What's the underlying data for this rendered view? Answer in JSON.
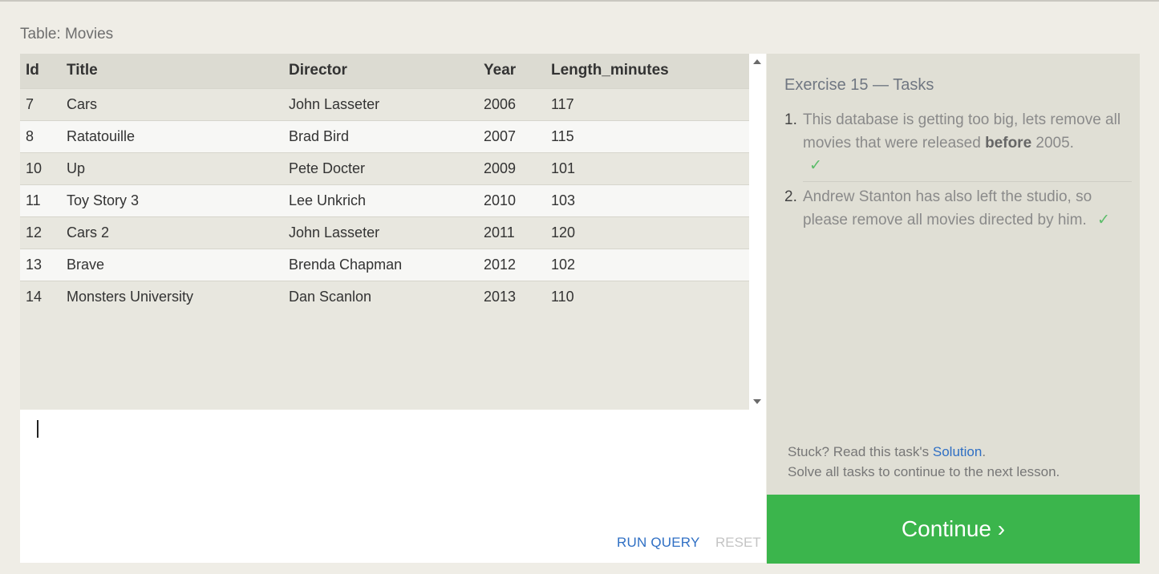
{
  "table_title": "Table: Movies",
  "table": {
    "columns": [
      "Id",
      "Title",
      "Director",
      "Year",
      "Length_minutes"
    ],
    "rows": [
      [
        "7",
        "Cars",
        "John Lasseter",
        "2006",
        "117"
      ],
      [
        "8",
        "Ratatouille",
        "Brad Bird",
        "2007",
        "115"
      ],
      [
        "10",
        "Up",
        "Pete Docter",
        "2009",
        "101"
      ],
      [
        "11",
        "Toy Story 3",
        "Lee Unkrich",
        "2010",
        "103"
      ],
      [
        "12",
        "Cars 2",
        "John Lasseter",
        "2011",
        "120"
      ],
      [
        "13",
        "Brave",
        "Brenda Chapman",
        "2012",
        "102"
      ],
      [
        "14",
        "Monsters University",
        "Dan Scanlon",
        "2013",
        "110"
      ]
    ]
  },
  "editor": {
    "value": "",
    "run_label": "RUN QUERY",
    "reset_label": "RESET"
  },
  "tasks": {
    "heading": "Exercise 15 — Tasks",
    "items": [
      {
        "number": "1.",
        "text_before": "This database is getting too big, lets remove all movies that were released ",
        "bold": "before",
        "text_after": " 2005.",
        "check": "✓"
      },
      {
        "number": "2.",
        "text": "Andrew Stanton has also left the studio, so please remove all movies directed by him.",
        "check": "✓"
      }
    ],
    "stuck_prefix": "Stuck? Read this task's ",
    "solution_link": "Solution",
    "stuck_suffix": ".",
    "solve_all": "Solve all tasks to continue to the next lesson."
  },
  "continue_label": "Continue ›",
  "icons": {
    "scroll_up": "triangle-up",
    "scroll_down": "triangle-down",
    "check": "checkmark"
  },
  "colors": {
    "background": "#efede6",
    "accent_link": "#2f6fc4",
    "continue_bg": "#3bb54c",
    "check": "#5cbd6a"
  }
}
